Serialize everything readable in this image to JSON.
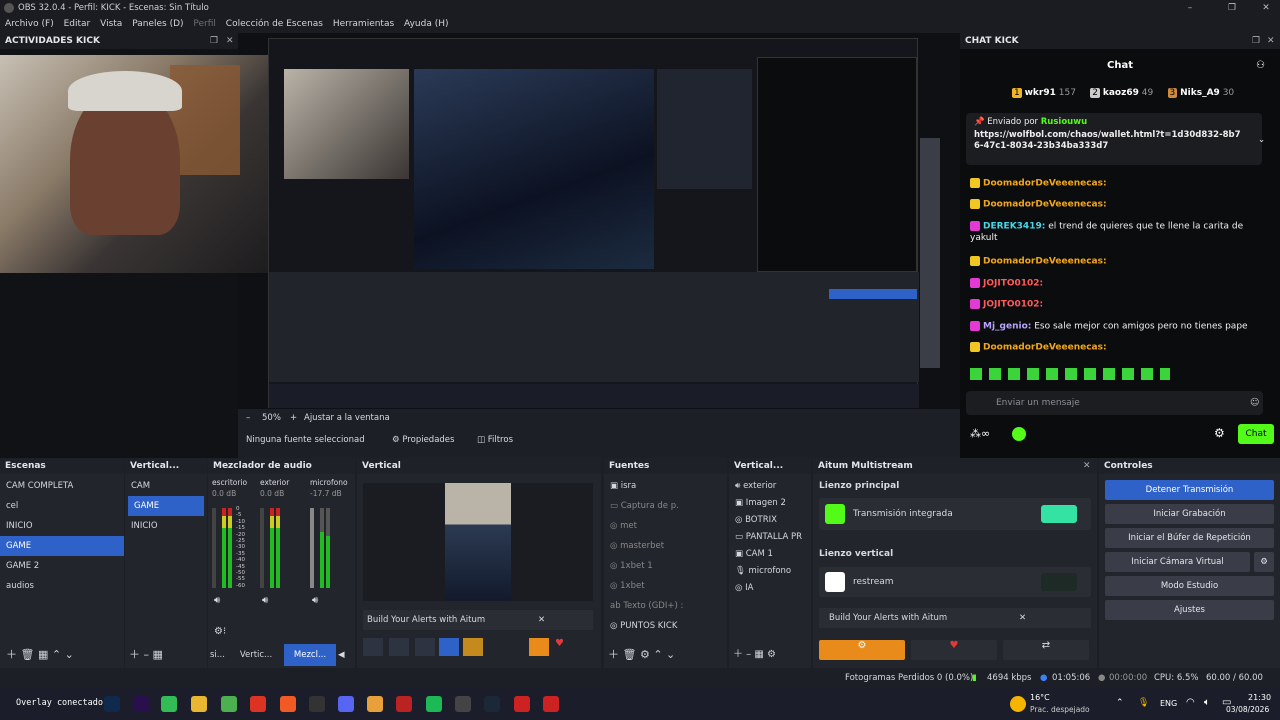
{
  "window": {
    "title": "OBS 32.0.4 - Perfil: KICK - Escenas: Sin Título"
  },
  "menu": [
    "Archivo (F)",
    "Editar",
    "Vista",
    "Paneles (D)",
    "Perfil",
    "Colección de Escenas",
    "Herramientas",
    "Ayuda (H)"
  ],
  "left_dock": {
    "title": "ACTIVIDADES KICK"
  },
  "chat_dock": {
    "title": "CHAT KICK",
    "header": "Chat",
    "placeholder": "Enviar un mensaje",
    "chat_button": "Chat",
    "leaders": [
      {
        "rank": "1",
        "name": "wkr91",
        "score": "157"
      },
      {
        "rank": "2",
        "name": "kaoz69",
        "score": "49"
      },
      {
        "rank": "3",
        "name": "Niks_A9",
        "score": "30"
      }
    ],
    "pinned_by": "Enviado por",
    "pinned_user": "Rusiouwu",
    "pinned_link": "https://wolfbol.com/chaos/wallet.html?t=1d30d832-8b76-47c1-8034-23b34ba333d7",
    "messages": [
      {
        "name": "DoomadorDeVeeenecas:",
        "text": "",
        "color": "#f2a71b"
      },
      {
        "name": "DoomadorDeVeeenecas:",
        "text": "",
        "color": "#f2a71b"
      },
      {
        "name": "DEREK3419:",
        "text": "el trend de quieres que te llene la carita de yakult",
        "color": "#47d7e8"
      },
      {
        "name": "DoomadorDeVeeenecas:",
        "text": "",
        "color": "#f2a71b"
      },
      {
        "name": "JOJITO0102:",
        "text": "",
        "color": "#ff5b5b"
      },
      {
        "name": "JOJITO0102:",
        "text": "",
        "color": "#ff5b5b"
      },
      {
        "name": "Mj_genio:",
        "text": "Eso sale mejor con amigos pero no tienes pape",
        "color": "#b7a4ff"
      },
      {
        "name": "DoomadorDeVeeenecas:",
        "text": "",
        "color": "#f2a71b"
      }
    ]
  },
  "preview": {
    "zoom": "50%",
    "fit": "Ajustar a la ventana",
    "no_source": "Ninguna fuente seleccionad",
    "properties": "Propiedades",
    "filters": "Filtros"
  },
  "scenes": {
    "title": "Escenas",
    "items": [
      "CAM COMPLETA",
      "cel",
      "INICIO",
      "GAME",
      "GAME 2",
      "audios"
    ],
    "selected": 3
  },
  "vscenes": {
    "title": "Vertical...",
    "items": [
      "CAM",
      "GAME",
      "INICIO"
    ],
    "selected": 1
  },
  "mixer": {
    "title": "Mezclador de audio",
    "channels": [
      {
        "name": "escritorio",
        "db": "0.0 dB"
      },
      {
        "name": "exterior",
        "db": "0.0 dB"
      },
      {
        "name": "microfono",
        "db": "-17.7 dB"
      }
    ],
    "scale": [
      "0",
      "-5",
      "-10",
      "-15",
      "-20",
      "-25",
      "-30",
      "-35",
      "-40",
      "-45",
      "-50",
      "-55",
      "-60"
    ],
    "tabs": [
      "si...",
      "Vertic...",
      "Mezcl..."
    ]
  },
  "vertical": {
    "title": "Vertical",
    "alert_bar": "Build Your Alerts with Aitum"
  },
  "sources": {
    "title": "Fuentes",
    "items": [
      "isra",
      "Captura de p.",
      "met",
      "masterbet",
      "1xbet 1",
      "1xbet",
      "Texto (GDI+) :",
      "PUNTOS KICK"
    ]
  },
  "vsources": {
    "title": "Vertical...",
    "items": [
      "exterior",
      "Imagen 2",
      "BOTRIX",
      "PANTALLA PR",
      "CAM 1",
      "microfono",
      "IA"
    ]
  },
  "aitum": {
    "title": "Aitum Multistream",
    "main_canvas": "Lienzo principal",
    "main_target": "Transmisión integrada",
    "vert_canvas": "Lienzo vertical",
    "vert_target": "restream",
    "alert_bar": "Build Your Alerts with Aitum"
  },
  "controls": {
    "title": "Controles",
    "buttons": [
      "Detener Transmisión",
      "Iniciar Grabación",
      "Iniciar el Búfer de Repetición",
      "Iniciar Cámara Virtual",
      "Modo Estudio",
      "Ajustes"
    ]
  },
  "status": {
    "frames": "Fotogramas Perdidos 0 (0.0%)",
    "bitrate": "4694 kbps",
    "live_time": "01:05:06",
    "rec_time": "00:00:00",
    "cpu": "CPU: 6.5%",
    "fps": "60.00 / 60.00 FPS"
  },
  "taskbar": {
    "overlay": "Overlay conectado.",
    "temp": "16°C",
    "weather": "Prac. despejado",
    "lang": "ENG",
    "time": "21:30",
    "date": "03/08/2026"
  }
}
